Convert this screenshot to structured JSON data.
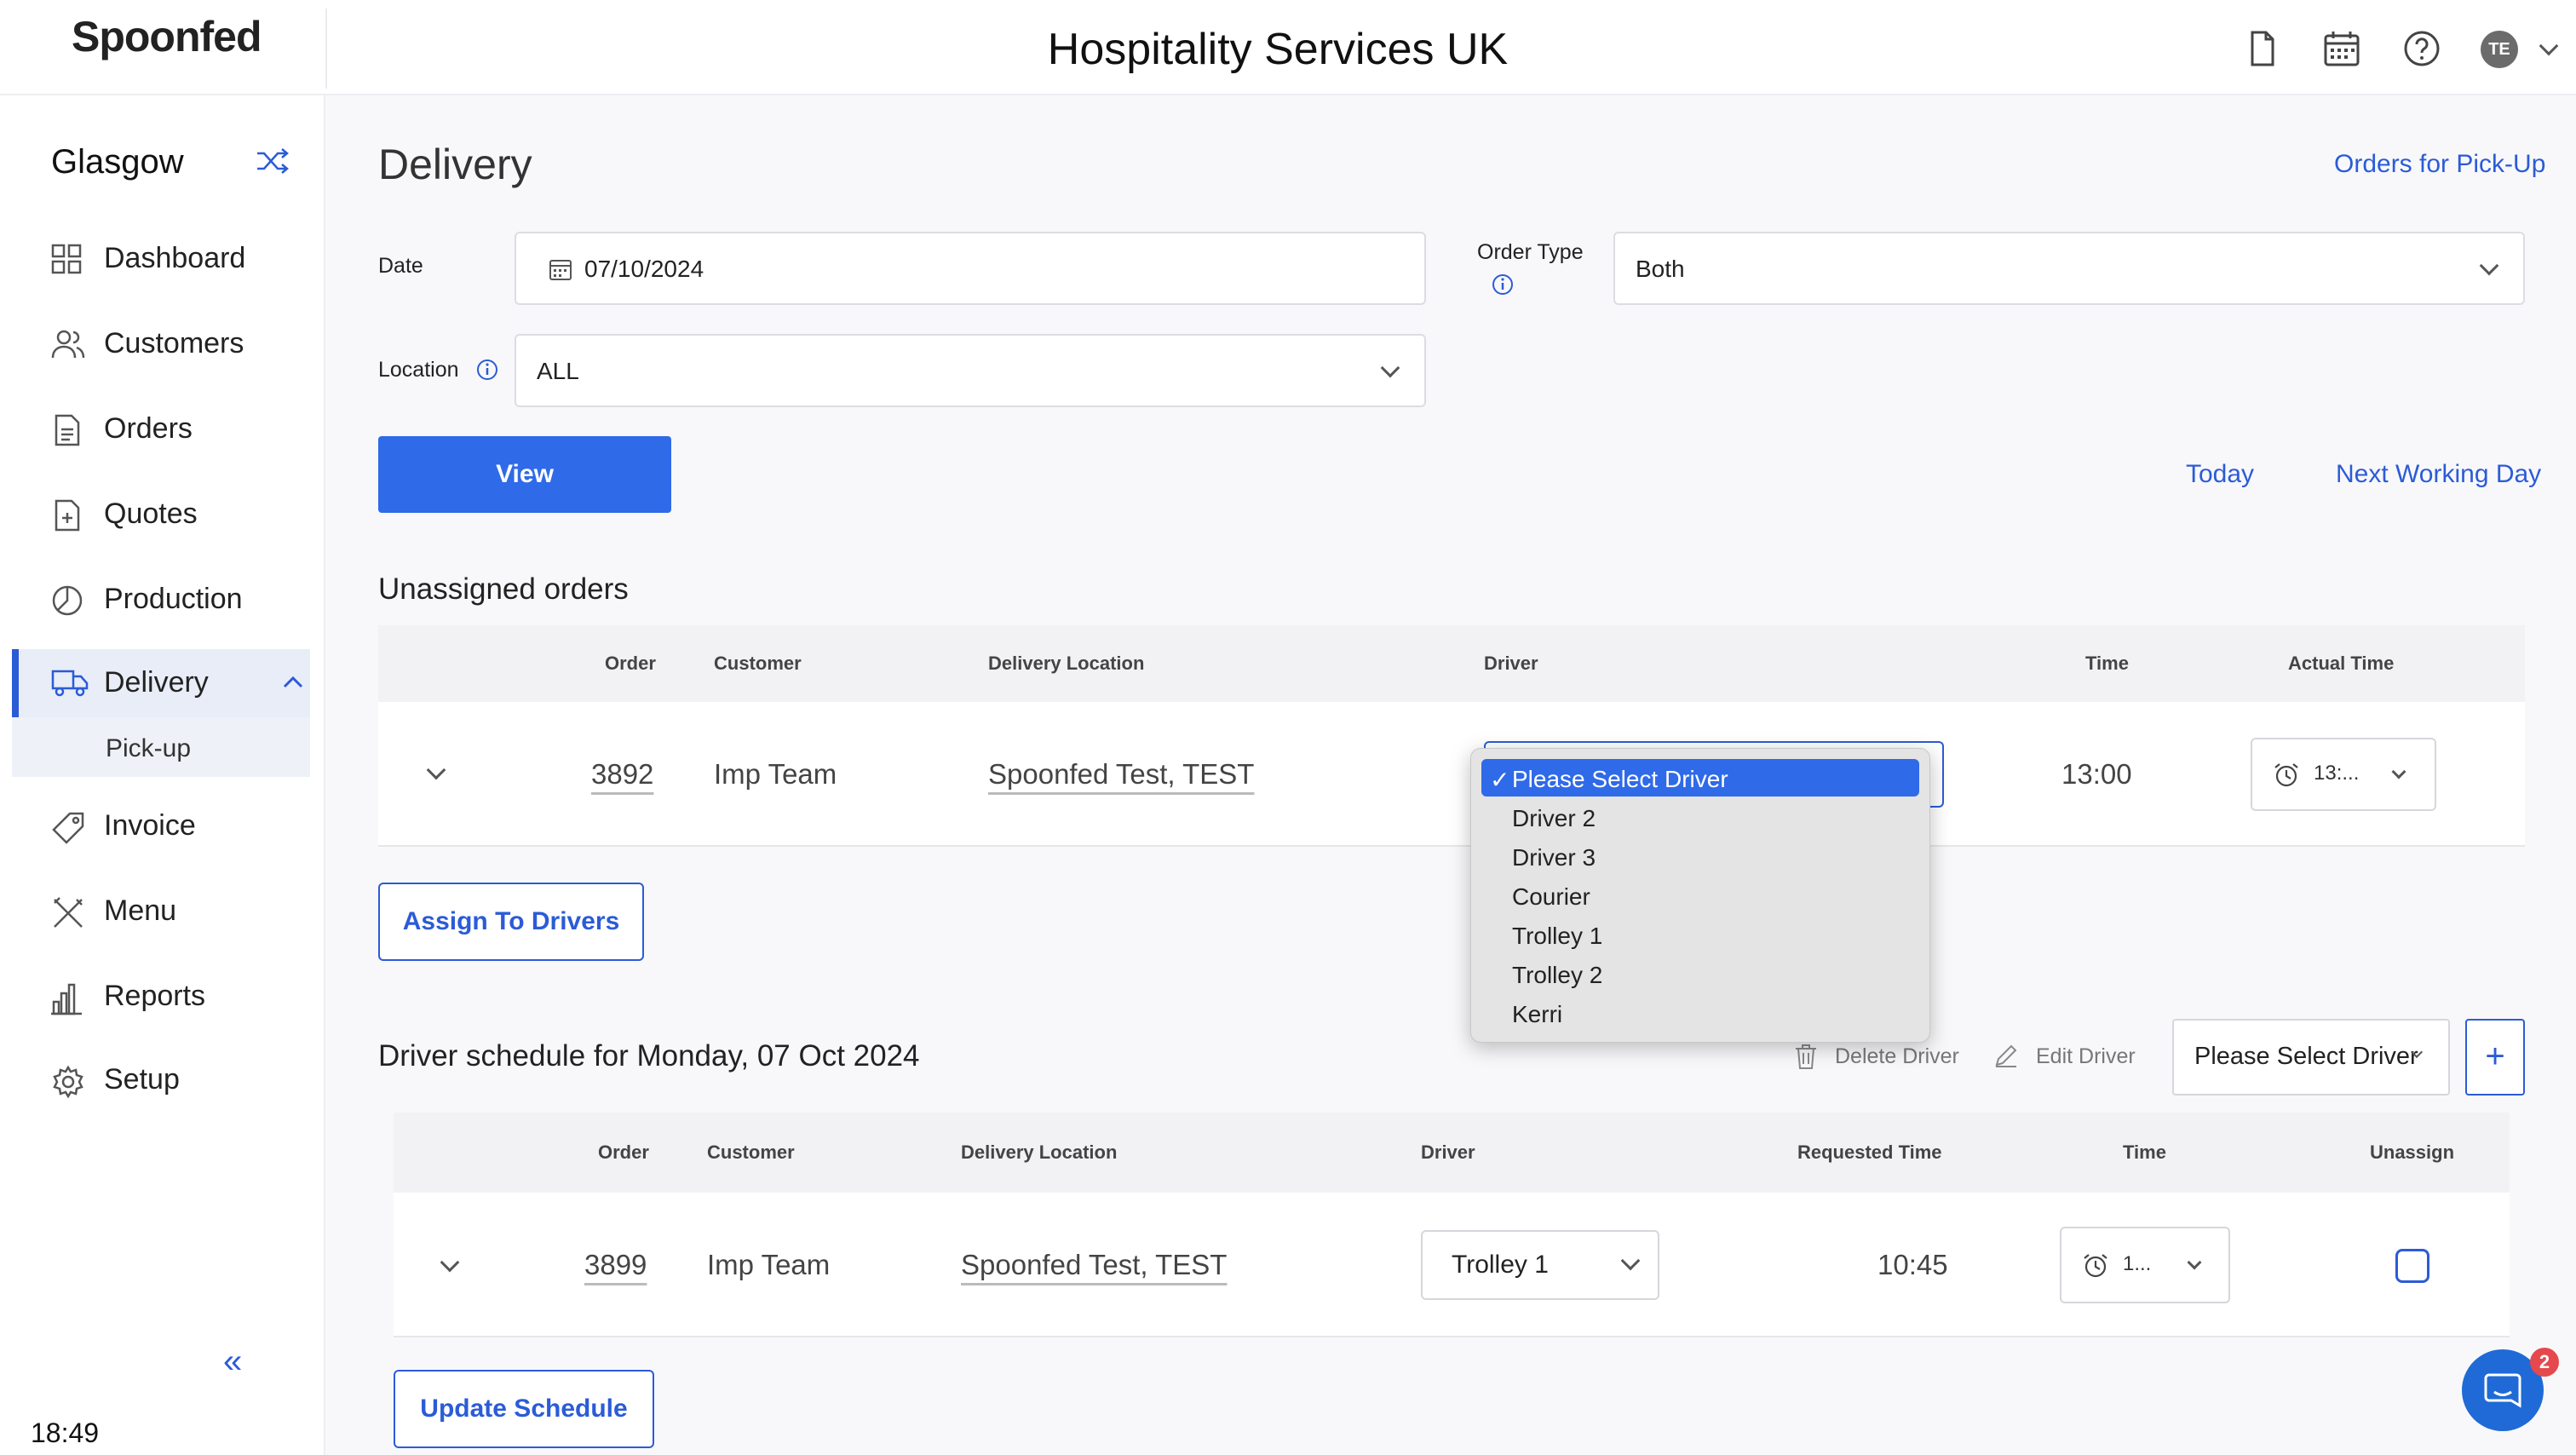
{
  "header": {
    "logo_text": "Spoonfed",
    "title": "Hospitality Services UK",
    "avatar_initials": "TE",
    "icons": [
      "document-icon",
      "calendar-icon",
      "help-icon",
      "chevron-down-icon"
    ]
  },
  "sidebar": {
    "site_name": "Glasgow",
    "items": [
      {
        "label": "Dashboard",
        "icon": "dashboard-icon"
      },
      {
        "label": "Customers",
        "icon": "customers-icon"
      },
      {
        "label": "Orders",
        "icon": "orders-icon"
      },
      {
        "label": "Quotes",
        "icon": "quotes-icon"
      },
      {
        "label": "Production",
        "icon": "production-icon"
      },
      {
        "label": "Delivery",
        "icon": "truck-icon",
        "active": true
      },
      {
        "label": "Invoice",
        "icon": "tag-icon"
      },
      {
        "label": "Menu",
        "icon": "utensils-icon"
      },
      {
        "label": "Reports",
        "icon": "reports-icon"
      },
      {
        "label": "Setup",
        "icon": "settings-icon"
      }
    ],
    "subnav_label": "Pick-up",
    "clock": "18:49"
  },
  "page": {
    "title": "Delivery",
    "pickup_link": "Orders for Pick-Up",
    "date_label": "Date",
    "date_value": "07/10/2024",
    "order_type_label": "Order Type",
    "order_type_value": "Both",
    "location_label": "Location",
    "location_value": "ALL",
    "view_button": "View",
    "today_link": "Today",
    "next_day_link": "Next Working Day"
  },
  "unassigned": {
    "heading": "Unassigned orders",
    "columns": {
      "order": "Order",
      "customer": "Customer",
      "location": "Delivery Location",
      "driver": "Driver",
      "time": "Time",
      "actual_time": "Actual Time"
    },
    "row": {
      "order": "3892",
      "customer": "Imp Team",
      "location": "Spoonfed Test, TEST",
      "time": "13:00",
      "actual_time": "13:..."
    },
    "assign_button": "Assign To Drivers"
  },
  "driver_dropdown": {
    "options": [
      "Please Select Driver",
      "Driver 2",
      "Driver 3",
      "Courier",
      "Trolley 1",
      "Trolley 2",
      "Kerri"
    ],
    "selected": "Please Select Driver",
    "check": "✓"
  },
  "schedule": {
    "heading": "Driver schedule for Monday, 07 Oct 2024",
    "delete_driver": "Delete Driver",
    "edit_driver": "Edit Driver",
    "select_driver": "Please Select Driver",
    "add_button": "+",
    "columns": {
      "order": "Order",
      "customer": "Customer",
      "location": "Delivery Location",
      "driver": "Driver",
      "requested_time": "Requested Time",
      "time": "Time",
      "unassign": "Unassign"
    },
    "row": {
      "order": "3899",
      "customer": "Imp Team",
      "location": "Spoonfed Test, TEST",
      "driver": "Trolley 1",
      "requested_time": "10:45",
      "time": "1..."
    },
    "update_button": "Update Schedule"
  },
  "chat": {
    "badge": "2"
  },
  "colors": {
    "accent": "#2f6ae8",
    "link": "#2b5bd7",
    "badge": "#e5484d"
  }
}
